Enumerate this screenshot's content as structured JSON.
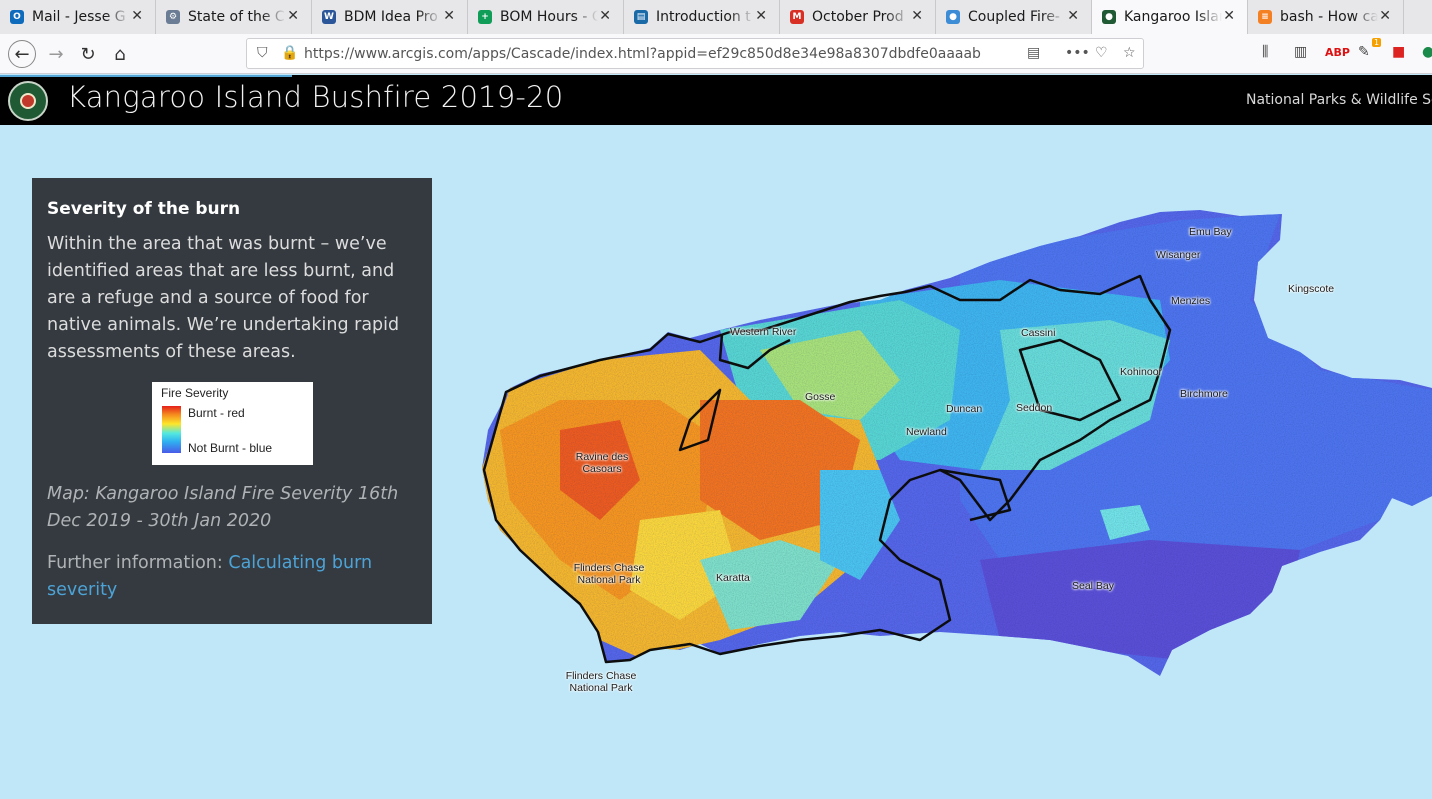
{
  "browser": {
    "tabs": [
      {
        "label": "Mail - Jesse G",
        "icon": "outlook-icon",
        "color": "#0f6cbd",
        "glyph": "O"
      },
      {
        "label": "State of the C",
        "icon": "settings-globe-icon",
        "color": "#6b7d94",
        "glyph": "⚙"
      },
      {
        "label": "BDM Idea Pro",
        "icon": "word-icon",
        "color": "#2b579a",
        "glyph": "W"
      },
      {
        "label": "BOM Hours - C",
        "icon": "sheets-icon",
        "color": "#0f9d58",
        "glyph": "+"
      },
      {
        "label": "Introduction t",
        "icon": "docs-icon",
        "color": "#1b6aa8",
        "glyph": "▤"
      },
      {
        "label": "October Prod",
        "icon": "gmail-icon",
        "color": "#d93025",
        "glyph": "M"
      },
      {
        "label": "Coupled Fire-",
        "icon": "globe-icon",
        "color": "#3c8dd6",
        "glyph": "●"
      },
      {
        "label": "Kangaroo Islar",
        "icon": "arcgis-icon",
        "color": "#1f5a34",
        "glyph": "●"
      },
      {
        "label": "bash - How ca",
        "icon": "stackoverflow-icon",
        "color": "#f48024",
        "glyph": "≡"
      }
    ],
    "active_tab": 7,
    "url": "https://www.arcgis.com/apps/Cascade/index.html?appid=ef29c850d8e34e98a8307dbdfe0aaaab",
    "toolbar_badge": "1"
  },
  "header": {
    "title": "Kangaroo Island Bushfire 2019-20",
    "agency": "National Parks & Wildlife Servi"
  },
  "panel": {
    "title": "Severity of the burn",
    "body": "Within the area that was burnt – we’ve identified areas that are less burnt, and are a refuge and a source of food for native animals. We’re undertaking rapid assessments of these areas.",
    "legend": {
      "title": "Fire Severity",
      "high_label": "Burnt - red",
      "low_label": "Not Burnt - blue",
      "colors": [
        "#e5201b",
        "#f58a1e",
        "#fde62a",
        "#53e8df",
        "#2fb0f0",
        "#4a5ae8"
      ]
    },
    "caption": "Map: Kangaroo Island Fire Severity 16th Dec 2019 - 30th Jan 2020",
    "further_prefix": "Further information: ",
    "further_link": "Calculating burn severity"
  },
  "map": {
    "sea_color": "#bfe7f8",
    "places": [
      {
        "name": "Emu Bay"
      },
      {
        "name": "Wisanger"
      },
      {
        "name": "Kingscote"
      },
      {
        "name": "Menzies"
      },
      {
        "name": "Western River"
      },
      {
        "name": "Cassini"
      },
      {
        "name": "Kohinoor"
      },
      {
        "name": "Birchmore"
      },
      {
        "name": "Gosse"
      },
      {
        "name": "Duncan"
      },
      {
        "name": "Seddon"
      },
      {
        "name": "Newland"
      },
      {
        "name": "Ravine des Casoars"
      },
      {
        "name": "Flinders Chase National Park"
      },
      {
        "name": "Karatta"
      },
      {
        "name": "Seal Bay"
      },
      {
        "name": "Flinders Chase National Park"
      }
    ]
  }
}
